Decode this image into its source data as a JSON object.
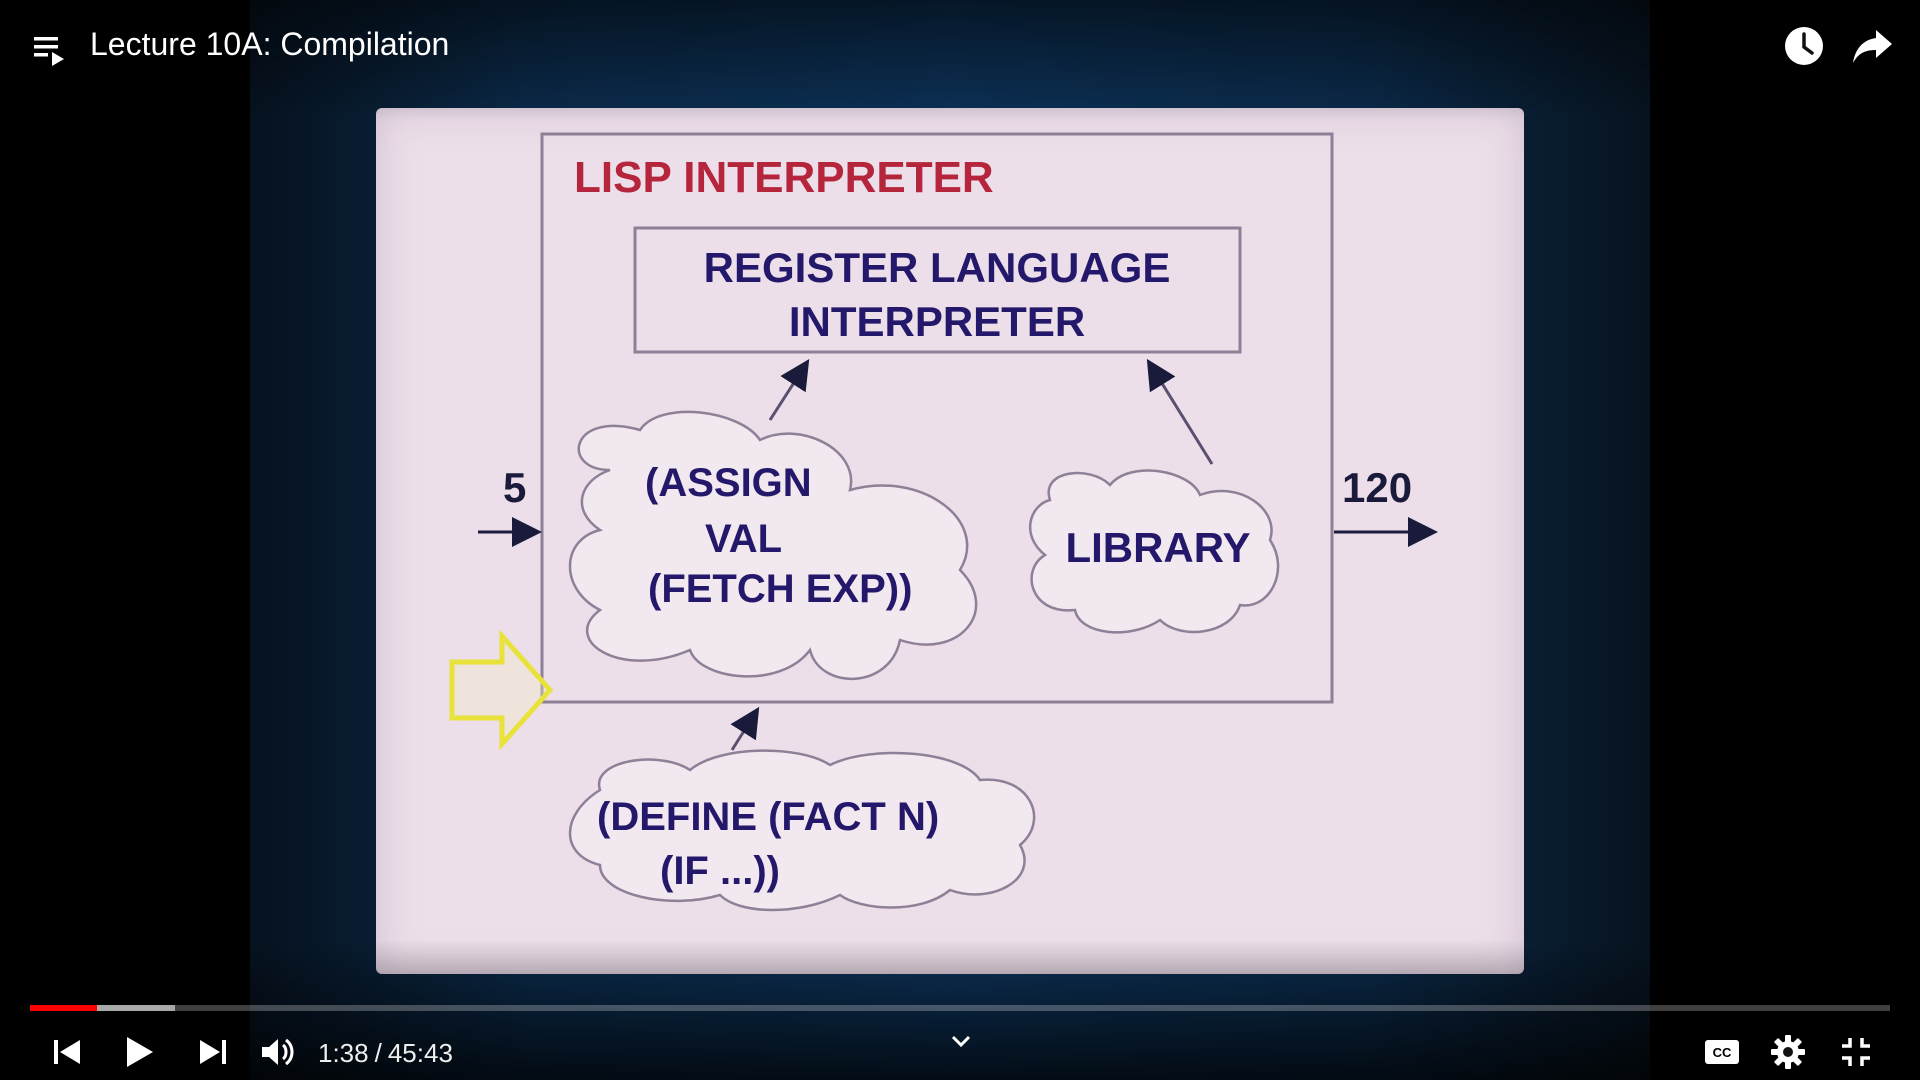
{
  "player": {
    "title": "Lecture 10A: Compilation",
    "current_time": "1:38",
    "time_separator": "/",
    "duration": "45:43",
    "played_fraction": 0.036,
    "buffered_fraction": 0.078,
    "progress_color": "#ff0000"
  },
  "icons": {
    "playlist": "playlist-icon",
    "watch_later": "clock-icon",
    "share": "share-arrow-icon",
    "previous": "skip-previous-icon",
    "play": "play-icon",
    "next": "skip-next-icon",
    "volume": "volume-icon",
    "expand": "chevron-down-icon",
    "captions": "cc-icon",
    "settings": "gear-icon",
    "fullscreen": "exit-fullscreen-icon"
  },
  "slide": {
    "outer_box_title": "LISP INTERPRETER",
    "inner_box_line1": "REGISTER LANGUAGE",
    "inner_box_line2": "INTERPRETER",
    "cloud_code_line1": "(ASSIGN",
    "cloud_code_line2": "VAL",
    "cloud_code_line3": "(FETCH EXP))",
    "cloud_library": "LIBRARY",
    "cloud_define_line1": "(DEFINE (FACT N)",
    "cloud_define_line2": "(IF ...))",
    "input_value": "5",
    "output_value": "120",
    "colors": {
      "slide_bg": "#ecdfe9",
      "title_red": "#b5253c",
      "text_navy": "#24186a",
      "arrow_yellow": "#e8e23a"
    }
  }
}
